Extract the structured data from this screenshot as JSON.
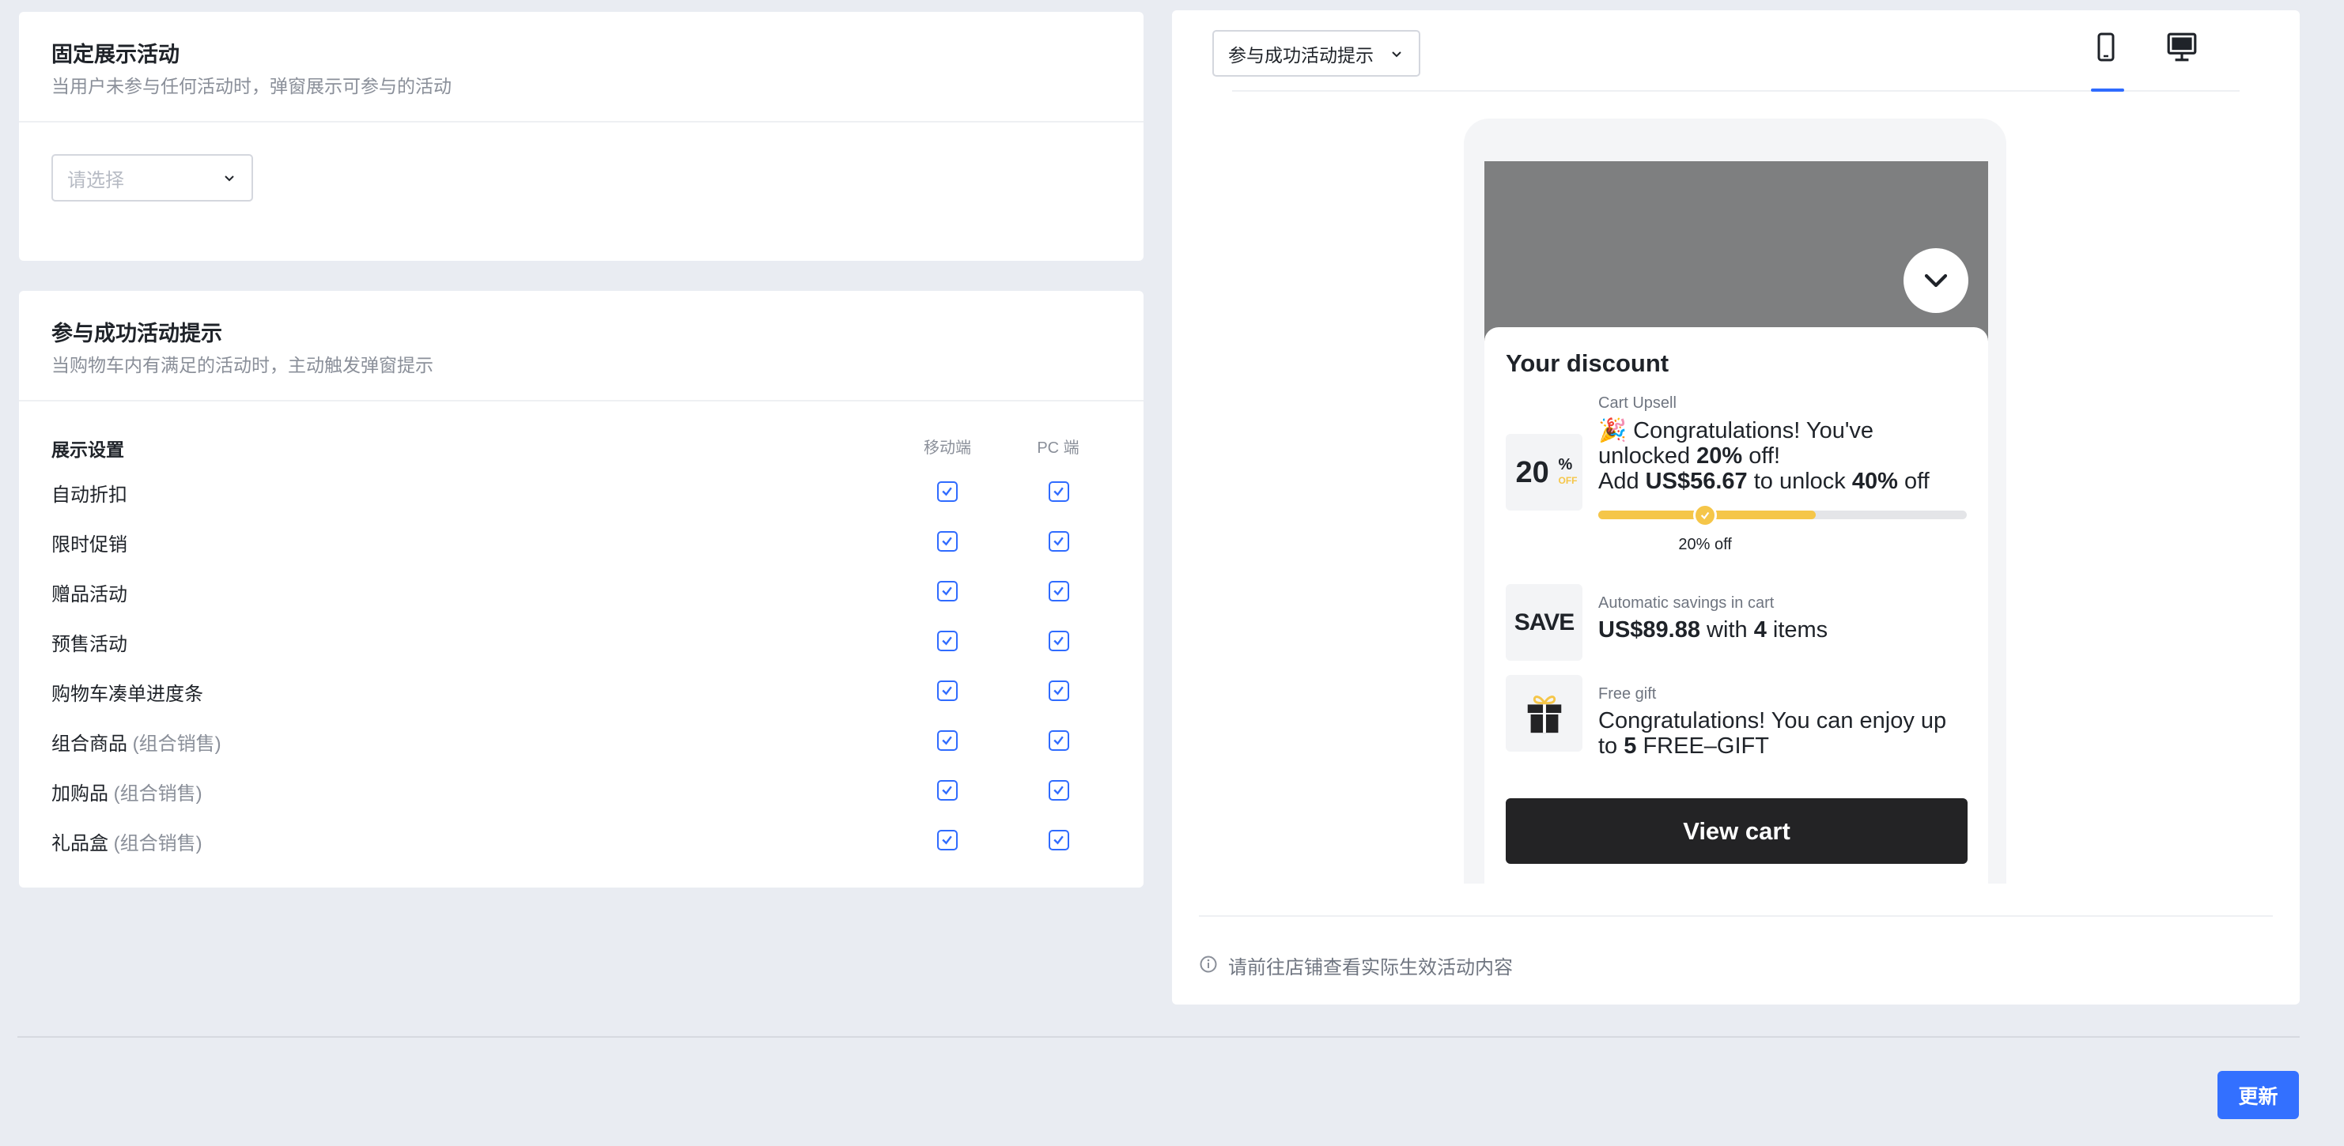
{
  "fixed_section": {
    "title": "固定展示活动",
    "description": "当用户未参与任何活动时，弹窗展示可参与的活动",
    "select_placeholder": "请选择"
  },
  "success_section": {
    "title": "参与成功活动提示",
    "description": "当购物车内有满足的活动时，主动触发弹窗提示",
    "settings_header": "展示设置",
    "col_mobile": "移动端",
    "col_pc": "PC 端",
    "rows": [
      {
        "label": "自动折扣",
        "sub": "",
        "mobile": true,
        "pc": true
      },
      {
        "label": "限时促销",
        "sub": "",
        "mobile": true,
        "pc": true
      },
      {
        "label": "赠品活动",
        "sub": "",
        "mobile": true,
        "pc": true
      },
      {
        "label": "预售活动",
        "sub": "",
        "mobile": true,
        "pc": true
      },
      {
        "label": "购物车凑单进度条",
        "sub": "",
        "mobile": true,
        "pc": true
      },
      {
        "label": "组合商品",
        "sub": " (组合销售)",
        "mobile": true,
        "pc": true
      },
      {
        "label": "加购品",
        "sub": " (组合销售)",
        "mobile": true,
        "pc": true
      },
      {
        "label": "礼品盒",
        "sub": " (组合销售)",
        "mobile": true,
        "pc": true
      }
    ]
  },
  "preview": {
    "select_value": "参与成功活动提示",
    "tabs": [
      {
        "name": "mobile",
        "icon": "mobile-icon",
        "active": true
      },
      {
        "name": "desktop",
        "icon": "desktop-icon",
        "active": false
      }
    ],
    "sheet_title": "Your discount",
    "upsell": {
      "icon_number": "20",
      "icon_percent": "%",
      "icon_off": "OFF",
      "tag": "Cart Upsell",
      "emoji": "🎉",
      "line1_a": " Congratulations! You've",
      "line2_a": "unlocked ",
      "line2_b": "20%",
      "line2_c": " off!",
      "line3_a": "Add ",
      "line3_b": "US$56.67",
      "line3_c": " to unlock ",
      "line3_d": "40%",
      "line3_e": " off",
      "progress_fraction": 0.59,
      "milestone_fraction": 0.29,
      "milestone_label": "20% off"
    },
    "savings": {
      "icon_text": "SAVE",
      "tag": "Automatic savings in cart",
      "amount": "US$89.88",
      "mid": " with ",
      "count": "4",
      "tail": " items"
    },
    "gift": {
      "icon": "gift-icon",
      "tag": "Free gift",
      "line1": "Congratulations! You can enjoy up",
      "line2_a": "to ",
      "line2_b": "5",
      "line2_c": " FREE–GIFT"
    },
    "view_cart_label": "View cart",
    "notice": "请前往店铺查看实际生效活动内容"
  },
  "footer": {
    "update_label": "更新"
  },
  "colors": {
    "accent": "#2f6bff",
    "button": "#3370ff",
    "progress": "#f5c649",
    "background": "#e9ecf2"
  }
}
